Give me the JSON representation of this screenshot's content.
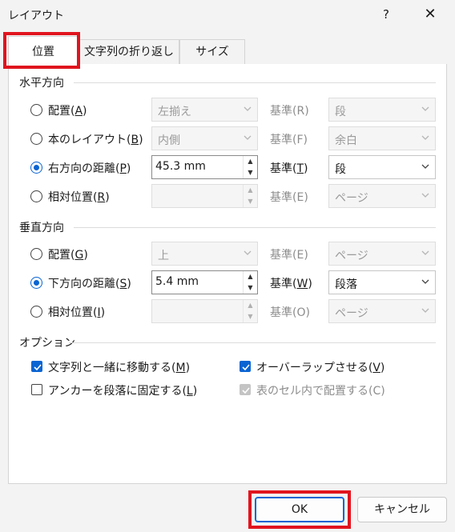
{
  "window": {
    "title": "レイアウト",
    "help": "?",
    "close": "✕"
  },
  "tabs": [
    {
      "label": "位置",
      "active": true
    },
    {
      "label": "文字列の折り返し",
      "active": false
    },
    {
      "label": "サイズ",
      "active": false
    }
  ],
  "horizontal": {
    "heading": "水平方向",
    "rows": [
      {
        "label_pre": "配置(",
        "key": "A",
        "label_post": ")",
        "checked": false,
        "field": "左揃え",
        "basis_pre": "基準(",
        "basis_key": "R",
        "basis_post": ")",
        "basis_value": "段",
        "enabled": false
      },
      {
        "label_pre": "本のレイアウト(",
        "key": "B",
        "label_post": ")",
        "checked": false,
        "field": "内側",
        "basis_pre": "基準(",
        "basis_key": "F",
        "basis_post": ")",
        "basis_value": "余白",
        "enabled": false
      },
      {
        "label_pre": "右方向の距離(",
        "key": "P",
        "label_post": ")",
        "checked": true,
        "field": "45.3 mm",
        "basis_pre": "基準(",
        "basis_key": "T",
        "basis_post": ")",
        "basis_value": "段",
        "enabled": true
      },
      {
        "label_pre": "相対位置(",
        "key": "R",
        "label_post": ")",
        "checked": false,
        "field": "",
        "basis_pre": "基準(",
        "basis_key": "E",
        "basis_post": ")",
        "basis_value": "ページ",
        "enabled": false
      }
    ]
  },
  "vertical": {
    "heading": "垂直方向",
    "rows": [
      {
        "label_pre": "配置(",
        "key": "G",
        "label_post": ")",
        "checked": false,
        "field": "上",
        "basis_pre": "基準(",
        "basis_key": "E",
        "basis_post": ")",
        "basis_value": "ページ",
        "enabled": false
      },
      {
        "label_pre": "下方向の距離(",
        "key": "S",
        "label_post": ")",
        "checked": true,
        "field": "5.4 mm",
        "basis_pre": "基準(",
        "basis_key": "W",
        "basis_post": ")",
        "basis_value": "段落",
        "enabled": true
      },
      {
        "label_pre": "相対位置(",
        "key": "I",
        "label_post": ")",
        "checked": false,
        "field": "",
        "basis_pre": "基準(",
        "basis_key": "O",
        "basis_post": ")",
        "basis_value": "ページ",
        "enabled": false
      }
    ]
  },
  "options": {
    "heading": "オプション",
    "move_with_text": {
      "label_pre": "文字列と一緒に移動する(",
      "key": "M",
      "label_post": ")",
      "checked": true
    },
    "lock_anchor": {
      "label_pre": "アンカーを段落に固定する(",
      "key": "L",
      "label_post": ")",
      "checked": false
    },
    "allow_overlap": {
      "label_pre": "オーバーラップさせる(",
      "key": "V",
      "label_post": ")",
      "checked": true
    },
    "layout_in_cell": {
      "label": "表のセル内で配置する(C)",
      "checked": true,
      "enabled": false
    }
  },
  "buttons": {
    "ok": "OK",
    "cancel": "キャンセル"
  },
  "colors": {
    "accent": "#0a64d2",
    "highlight": "#e0141e"
  }
}
